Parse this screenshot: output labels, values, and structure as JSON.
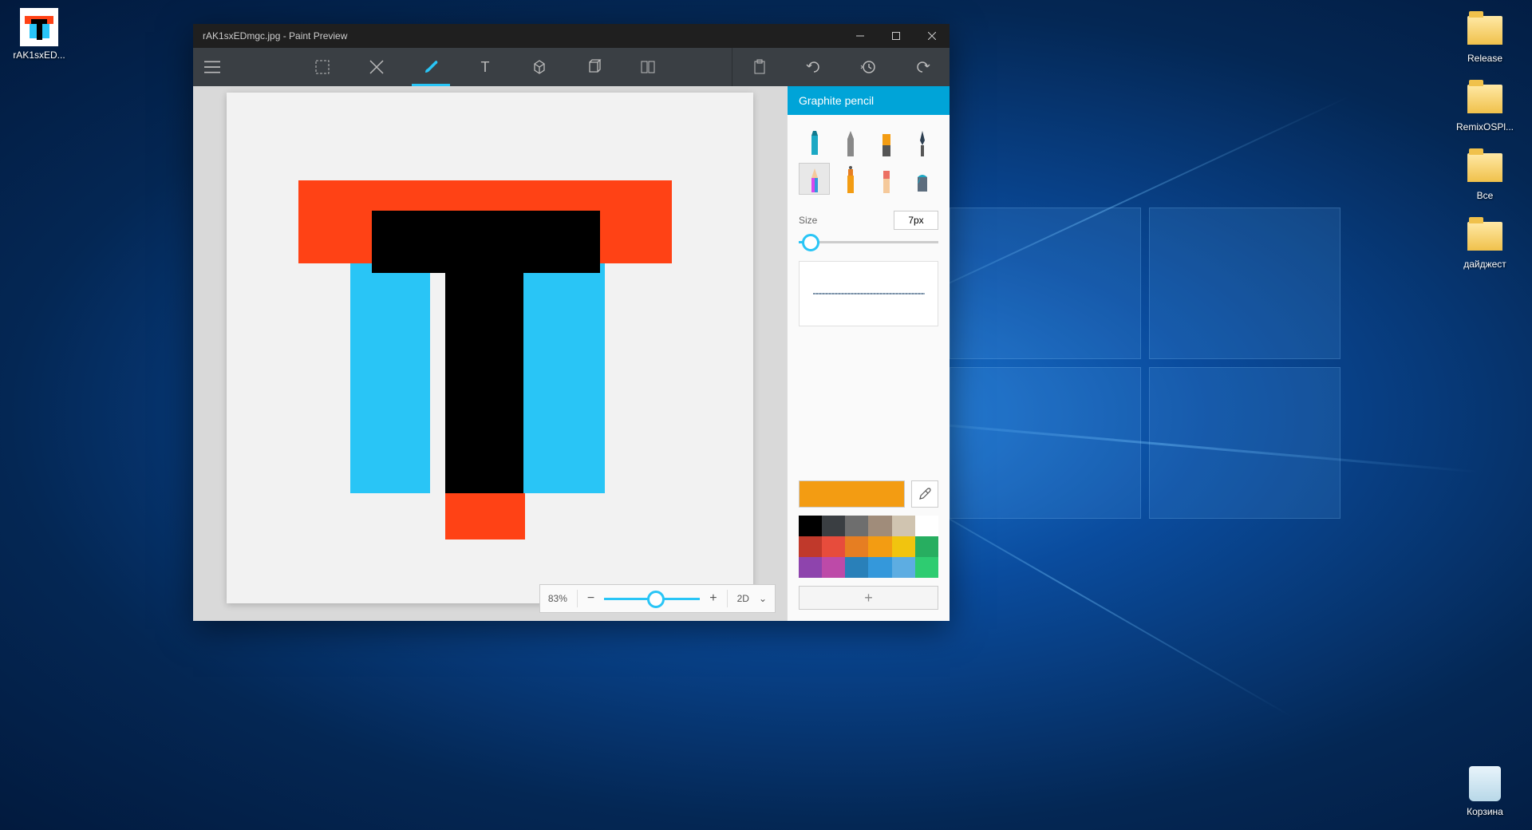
{
  "desktop": {
    "icons": [
      {
        "name": "rAK1sxED...",
        "type": "thumb"
      },
      {
        "name": "Release",
        "type": "folder"
      },
      {
        "name": "RemixOSPl...",
        "type": "folder"
      },
      {
        "name": "Все",
        "type": "folder"
      },
      {
        "name": "дайджест",
        "type": "folder"
      },
      {
        "name": "Корзина",
        "type": "recycle"
      }
    ]
  },
  "window": {
    "title": "rAK1sxEDmgc.jpg - Paint Preview"
  },
  "panel": {
    "header": "Graphite pencil",
    "size_label": "Size",
    "size_value": "7px"
  },
  "zoom": {
    "pct": "83%",
    "mode": "2D"
  },
  "colors": {
    "current": "#f39c12",
    "palette": [
      "#000000",
      "#3a3e42",
      "#6e6e6e",
      "#a08c7a",
      "#d0c4b0",
      "#ffffff",
      "#c0392b",
      "#e74c3c",
      "#e67e22",
      "#f39c12",
      "#f1c40f",
      "#27ae60",
      "#8e44ad",
      "#bd4aa8",
      "#2980b9",
      "#3498db",
      "#5dade2",
      "#2ecc71"
    ]
  },
  "icons": {
    "plus": "+",
    "minus": "−",
    "chevron": "⌄"
  }
}
